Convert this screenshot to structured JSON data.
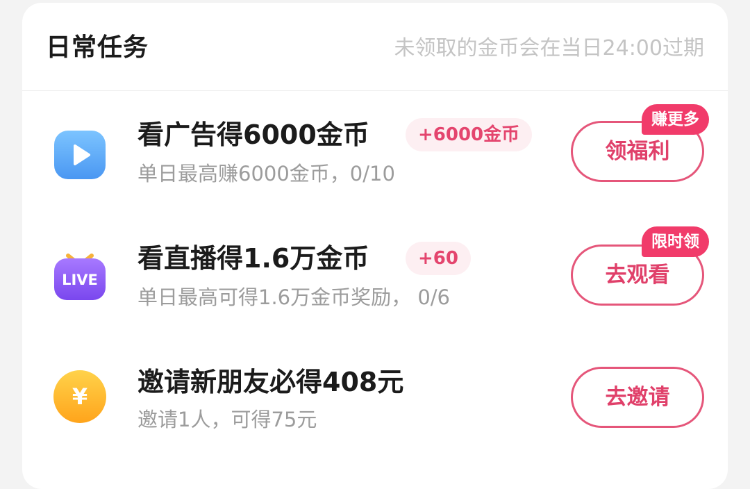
{
  "header": {
    "title": "日常任务",
    "expire_note": "未领取的金币会在当日24:00过期"
  },
  "tasks": [
    {
      "icon": "video-play-icon",
      "title": "看广告得6000金币",
      "reward": "+6000金币",
      "subtitle": "单日最高赚6000金币，0/10",
      "button": "领福利",
      "tag": "赚更多"
    },
    {
      "icon": "live-tv-icon",
      "icon_text": "LIVE",
      "title": "看直播得1.6万金币",
      "reward": "+60",
      "subtitle": "单日最高可得1.6万金币奖励， 0/6",
      "button": "去观看",
      "tag": "限时领"
    },
    {
      "icon": "yuan-coin-icon",
      "icon_text": "¥",
      "title": "邀请新朋友必得408元",
      "subtitle": "邀请1人，可得75元",
      "button": "去邀请"
    }
  ],
  "colors": {
    "accent": "#e5567a",
    "tag_bg": "#f13b6a",
    "pill_bg": "#fdeff2",
    "muted_text": "#9c9c9c"
  }
}
